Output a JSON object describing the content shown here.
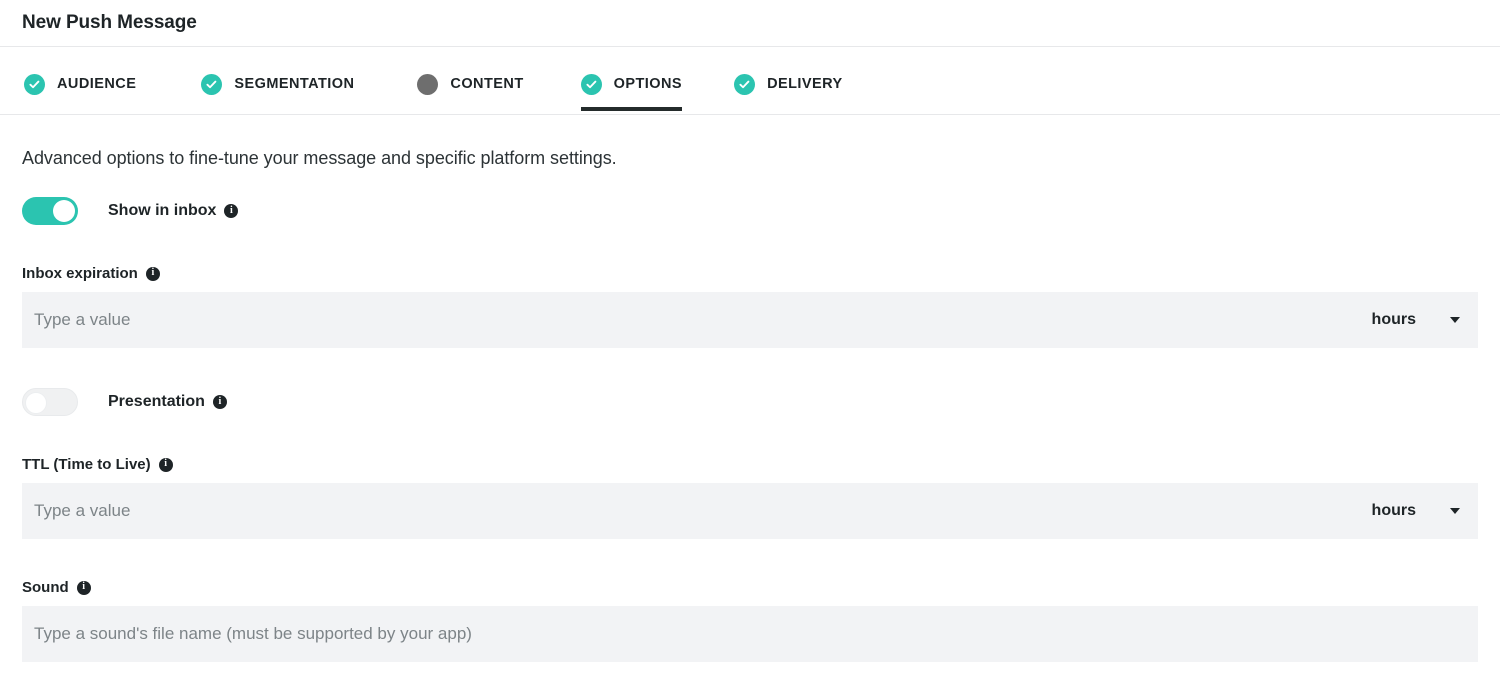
{
  "header": {
    "title": "New Push Message"
  },
  "tabs": [
    {
      "label": "AUDIENCE",
      "state": "done",
      "active": false
    },
    {
      "label": "SEGMENTATION",
      "state": "done",
      "active": false
    },
    {
      "label": "CONTENT",
      "state": "pending",
      "active": false
    },
    {
      "label": "OPTIONS",
      "state": "done",
      "active": true
    },
    {
      "label": "DELIVERY",
      "state": "done",
      "active": false
    }
  ],
  "main": {
    "intro": "Advanced options to fine-tune your message and specific platform settings.",
    "show_in_inbox": {
      "label": "Show in inbox",
      "enabled": true,
      "info_icon": "info-icon",
      "info_glyph": "i"
    },
    "inbox_expiration": {
      "label": "Inbox expiration",
      "value": "",
      "placeholder": "Type a value",
      "unit": "hours",
      "info_glyph": "i"
    },
    "presentation": {
      "label": "Presentation",
      "enabled": false,
      "info_glyph": "i"
    },
    "ttl": {
      "label": "TTL (Time to Live)",
      "value": "",
      "placeholder": "Type a value",
      "unit": "hours",
      "info_glyph": "i"
    },
    "sound": {
      "label": "Sound",
      "value": "",
      "placeholder": "Type a sound's file name (must be supported by your app)",
      "info_glyph": "i"
    }
  },
  "colors": {
    "accent_teal": "#2bc4b0",
    "pending_gray": "#6e6e6e",
    "text_dark": "#1e2427",
    "input_bg": "#f2f3f5",
    "active_underline": "#242b2b"
  }
}
